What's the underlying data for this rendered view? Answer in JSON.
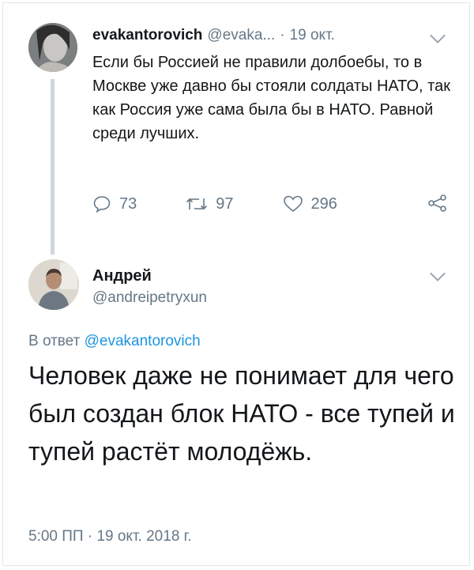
{
  "tweet1": {
    "author_name": "evakantorovich",
    "author_handle": "@evaka...",
    "separator": "·",
    "date": "19 окт.",
    "text": "Если бы Россией не правили долбоебы, то в Москве уже давно бы стояли солдаты НАТО, так как Россия уже сама была бы в НАТО.  Равной среди лучших.",
    "replies": "73",
    "retweets": "97",
    "likes": "296"
  },
  "tweet2": {
    "author_name": "Андрей",
    "author_handle": "@andreipetryxun",
    "reply_prefix": "В ответ",
    "reply_to": "@evakantorovich",
    "text": "Человек даже не понимает для чего был создан блок НАТО - все тупей и тупей растёт молодёжь.",
    "timestamp": "5:00 ПП · 19 окт. 2018 г."
  },
  "colors": {
    "text": "#14171a",
    "secondary": "#657786",
    "link": "#1b95e0",
    "thread_line": "#cfd6dc"
  },
  "icons": {
    "reply": "speech-bubble",
    "retweet": "arrows-loop",
    "like": "heart",
    "share": "share-nodes",
    "menu": "chevron-down"
  }
}
